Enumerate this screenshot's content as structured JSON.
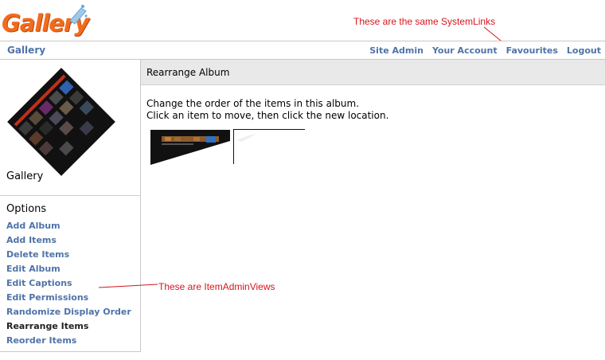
{
  "logo": {
    "text": "Gallery"
  },
  "annotations": {
    "system_links": "These are the same SystemLinks",
    "item_admin_views": "These are ItemAdminViews"
  },
  "header": {
    "title": "Gallery",
    "system_links": [
      "Site Admin",
      "Your Account",
      "Favourites",
      "Logout"
    ]
  },
  "sidebar": {
    "album_title": "Gallery",
    "options_heading": "Options",
    "links": [
      {
        "label": "Add Album"
      },
      {
        "label": "Add Items"
      },
      {
        "label": "Delete Items"
      },
      {
        "label": "Edit Album"
      },
      {
        "label": "Edit Captions"
      },
      {
        "label": "Edit Permissions"
      },
      {
        "label": "Randomize Display Order"
      },
      {
        "label": "Rearrange Items",
        "current": true
      },
      {
        "label": "Reorder Items"
      }
    ]
  },
  "main": {
    "heading": "Rearrange Album",
    "line1": "Change the order of the items in this album.",
    "line2": "Click an item to move, then click the new location."
  },
  "colors": {
    "link": "#4f73a8",
    "annotation": "#d7141b",
    "logo": "#f26b1d"
  }
}
